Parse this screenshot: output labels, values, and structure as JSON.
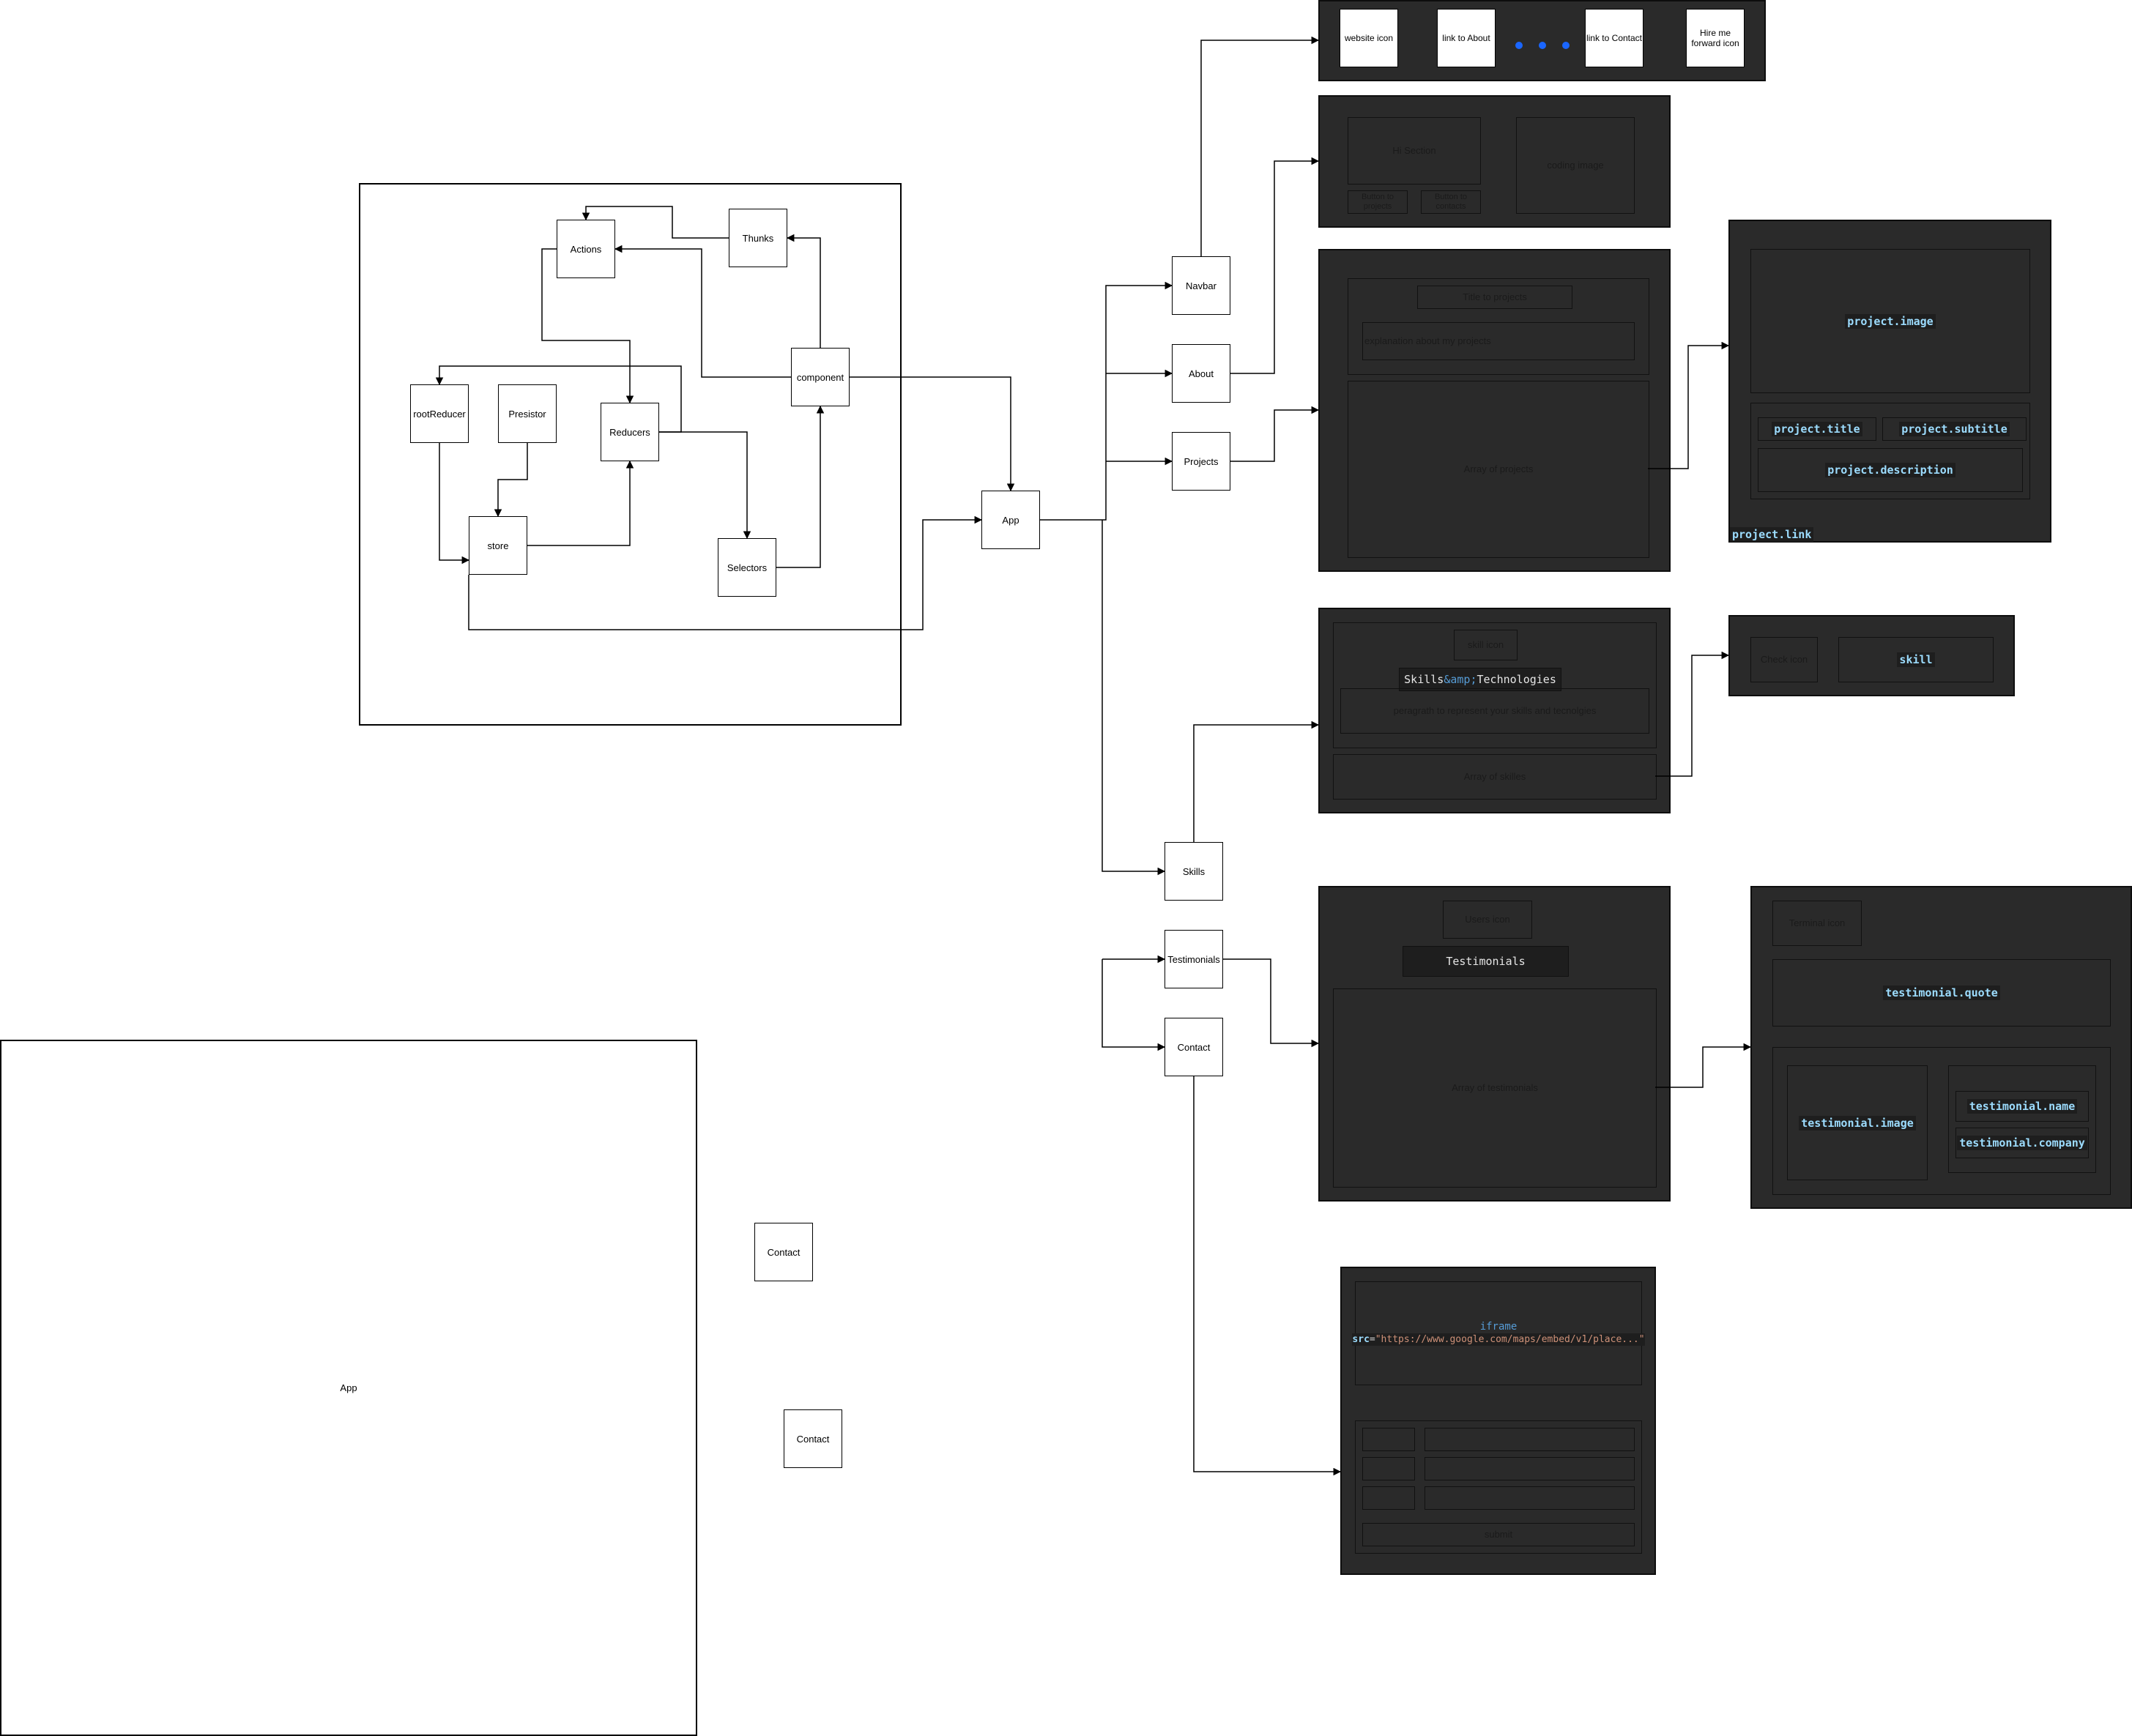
{
  "store_diagram": {
    "actions": "Actions",
    "thunks": "Thunks",
    "root_reducer": "rootReducer",
    "presistor": "Presistor",
    "reducers": "Reducers",
    "component": "component",
    "store": "store",
    "selectors": "Selectors"
  },
  "app_node": "App",
  "sections": {
    "navbar": "Navbar",
    "about": "About",
    "projects": "Projects",
    "skills": "Skills",
    "testimonials": "Testimonials",
    "contact": "Contact"
  },
  "navbar_panel": {
    "website_icon": "website icon",
    "link_about": "link to About",
    "link_contact": "link to Contact",
    "hire_me": "Hire me forward icon",
    "dot_color": "#1a66ff"
  },
  "about_panel": {
    "hi_section": "Hi Section",
    "coding_image": "coding image",
    "button_projects": "Button to projects",
    "button_contacts": "Button to contacts"
  },
  "projects_panel": {
    "title": "Title to projects",
    "explanation": "explanation about my projects",
    "array": "Array of projects"
  },
  "project_card": {
    "image": "project.image",
    "title": "project.title",
    "subtitle": "project.subtitle",
    "description": "project.description",
    "link": "project.link"
  },
  "skills_panel": {
    "icon": "skill icon",
    "heading_pre": "Skills ",
    "heading_amp": "&amp;",
    "heading_post": " Technologies",
    "paragraph": "peragrath to represent your skills and tecnolgies",
    "array": "Array of skilles"
  },
  "skill_card": {
    "check_icon": "Check icon",
    "skill": "skill"
  },
  "testimonials_panel": {
    "users_icon": "Users icon",
    "heading": "Testimonials",
    "array": "Array of testimonials"
  },
  "testimonial_card": {
    "terminal_icon": "Terminal icon",
    "quote": "testimonial.quote",
    "image": "testimonial.image",
    "name": "testimonial.name",
    "company": "testimonial.company"
  },
  "contact_panel": {
    "iframe_tag": "iframe",
    "src_attr": "src",
    "src_value": "\"https://www.google.com/maps/embed/v1/place...\"",
    "submit": "submit"
  },
  "loose_nodes": {
    "contact_a": "Contact",
    "contact_b": "Contact",
    "big_app": "App"
  }
}
